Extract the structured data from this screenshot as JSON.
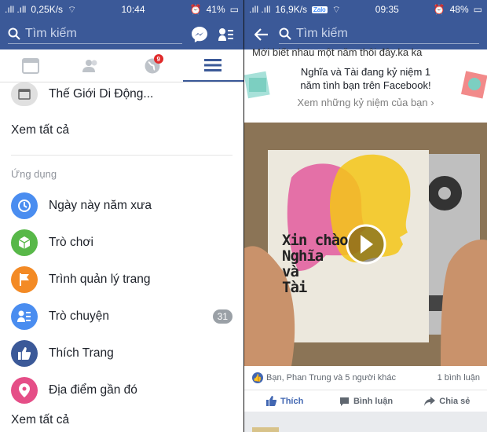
{
  "left": {
    "status": {
      "signal": ".ıll .ıll",
      "speed": "0,25K/s",
      "time": "10:44",
      "battery": "41%"
    },
    "search_placeholder": "Tìm kiếm",
    "tabs": {
      "notif_badge": "9"
    },
    "menu_top": {
      "label": "Thế Giới Di Động..."
    },
    "see_all_1": "Xem tất cả",
    "section_label": "Ứng dụng",
    "apps": [
      {
        "label": "Ngày này năm xưa",
        "color": "#4a8df0",
        "icon": "clock-icon"
      },
      {
        "label": "Trò chơi",
        "color": "#58b849",
        "icon": "cube-icon"
      },
      {
        "label": "Trình quản lý trang",
        "color": "#f38a25",
        "icon": "flag-icon"
      },
      {
        "label": "Trò chuyện",
        "color": "#4a8df0",
        "icon": "contacts-icon",
        "count": "31"
      },
      {
        "label": "Thích Trang",
        "color": "#3b5998",
        "icon": "thumbs-up-icon"
      },
      {
        "label": "Địa điểm gần đó",
        "color": "#e54e87",
        "icon": "location-pin-icon"
      }
    ],
    "see_all_2": "Xem tất cả"
  },
  "right": {
    "status": {
      "signal": ".ıll .ıll",
      "speed": "16,9K/s",
      "time": "09:35",
      "battery": "48%"
    },
    "search_placeholder": "Tìm kiếm",
    "cut_text": "Mới biết nhau một năm thôi đây.ka ka",
    "memory_title": "Nghĩa và Tài đang kỷ niệm 1 năm tình bạn trên Facebook!",
    "memory_link": "Xem những kỷ niệm của bạn",
    "video_text": [
      "Xin chào",
      "Nghĩa",
      "và",
      "Tài"
    ],
    "reactions_text": "Bạn, Phan Trung và 5 người khác",
    "comments_text": "1 bình luận",
    "actions": {
      "like": "Thích",
      "comment": "Bình luận",
      "share": "Chia sẻ"
    }
  },
  "colors": {
    "brand": "#3b5998",
    "link": "#4267b2"
  }
}
